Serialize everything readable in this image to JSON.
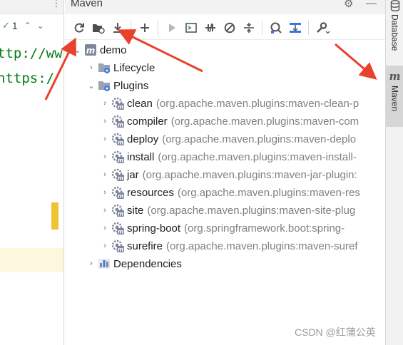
{
  "editor": {
    "inspection_count": "1",
    "code_lines": [
      "ttp://ww",
      "https:/"
    ]
  },
  "maven": {
    "title": "Maven",
    "toolbar": [
      {
        "name": "reload-all-projects-button",
        "icon": "reload-icon"
      },
      {
        "name": "generate-sources-button",
        "icon": "folder-sync-icon"
      },
      {
        "name": "download-sources-button",
        "icon": "download-icon"
      },
      {
        "name": "add-maven-project-button",
        "icon": "plus-icon"
      },
      {
        "name": "run-maven-build-button",
        "icon": "play-icon"
      },
      {
        "name": "execute-maven-goal-button",
        "icon": "terminal-icon"
      },
      {
        "name": "toggle-offline-mode-button",
        "icon": "offline-icon"
      },
      {
        "name": "skip-tests-button",
        "icon": "skip-tests-icon"
      },
      {
        "name": "show-dependencies-button",
        "icon": "collapse-icon"
      },
      {
        "name": "analyze-dependencies-button",
        "icon": "analyze-icon"
      },
      {
        "name": "show-diagram-button",
        "icon": "diagram-icon"
      },
      {
        "name": "maven-settings-button",
        "icon": "wrench-icon"
      }
    ],
    "tree": {
      "project": "demo",
      "lifecycle": "Lifecycle",
      "plugins_label": "Plugins",
      "plugins": [
        {
          "name": "clean",
          "coord": "(org.apache.maven.plugins:maven-clean-p"
        },
        {
          "name": "compiler",
          "coord": "(org.apache.maven.plugins:maven-com"
        },
        {
          "name": "deploy",
          "coord": "(org.apache.maven.plugins:maven-deplo"
        },
        {
          "name": "install",
          "coord": "(org.apache.maven.plugins:maven-install-"
        },
        {
          "name": "jar",
          "coord": "(org.apache.maven.plugins:maven-jar-plugin:"
        },
        {
          "name": "resources",
          "coord": "(org.apache.maven.plugins:maven-res"
        },
        {
          "name": "site",
          "coord": "(org.apache.maven.plugins:maven-site-plug"
        },
        {
          "name": "spring-boot",
          "coord": "(org.springframework.boot:spring-"
        },
        {
          "name": "surefire",
          "coord": "(org.apache.maven.plugins:maven-suref"
        }
      ],
      "dependencies": "Dependencies"
    }
  },
  "side_tabs": {
    "database": "Database",
    "maven": "Maven",
    "maven_glyph": "m"
  },
  "watermark": "CSDN @红蒲公英",
  "colors": {
    "accent": "#3574f0",
    "arrow": "#e8412c",
    "code_green": "#067d17",
    "secondary_text": "#808080"
  }
}
